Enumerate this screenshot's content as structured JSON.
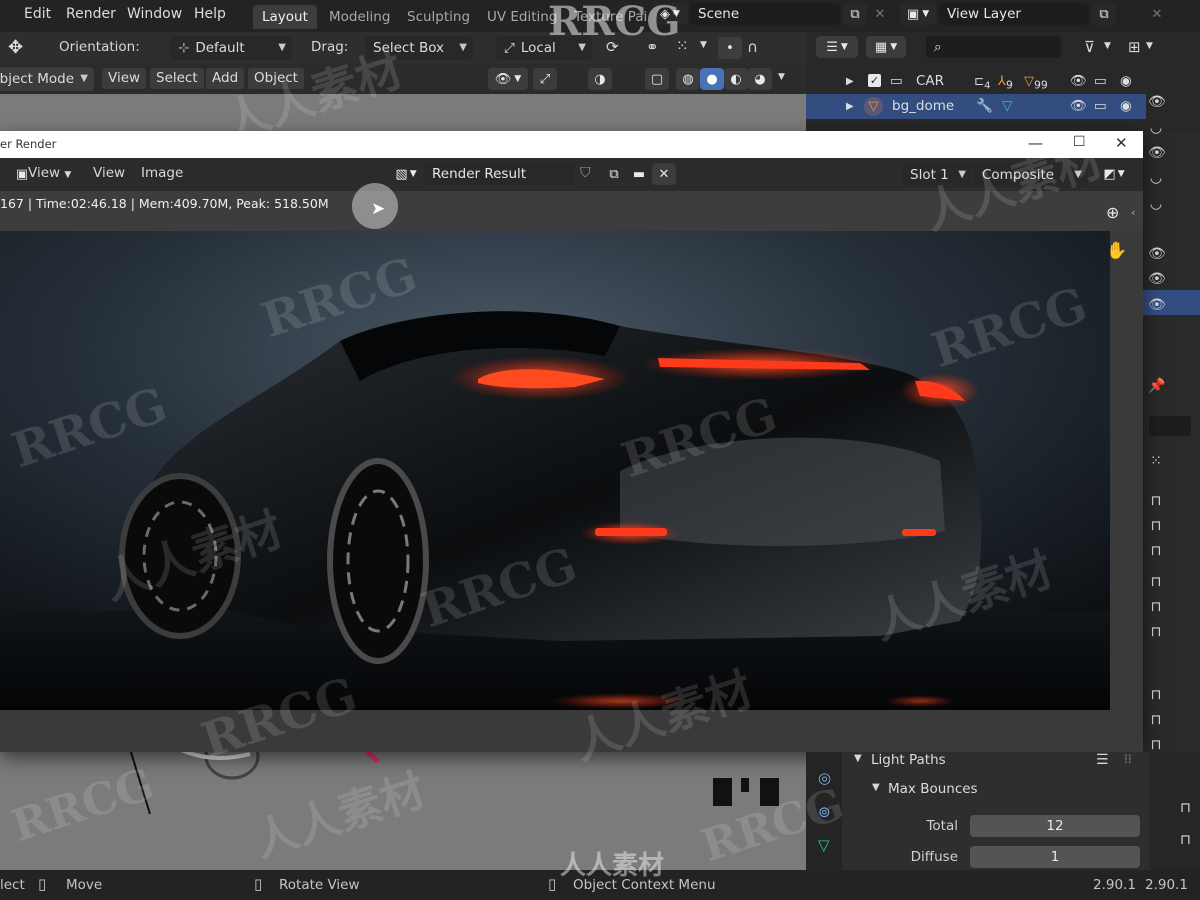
{
  "menu": [
    "Edit",
    "Render",
    "Window",
    "Help"
  ],
  "workspace_tabs": [
    {
      "label": "Layout",
      "active": true
    },
    {
      "label": "Modeling",
      "active": false
    },
    {
      "label": "Sculpting",
      "active": false
    },
    {
      "label": "UV Editing",
      "active": false
    },
    {
      "label": "Texture Pai",
      "active": false
    }
  ],
  "scene": {
    "value": "Scene"
  },
  "view_layer": {
    "value": "View Layer"
  },
  "tool_settings": {
    "orientation_label": "Orientation:",
    "orientation_value": "Default",
    "drag_label": "Drag:",
    "drag_value": "Select Box",
    "transform_value": "Local"
  },
  "viewport_header": {
    "mode": "Object Mode",
    "buttons": [
      "View",
      "Select",
      "Add",
      "Object"
    ]
  },
  "outliner": {
    "rows": [
      {
        "name": "CAR",
        "badges": [
          "4",
          "9",
          "99"
        ],
        "selected": false
      },
      {
        "name": "bg_dome",
        "badges": [],
        "selected": true
      }
    ]
  },
  "render_window": {
    "title": "er Render",
    "menus": [
      "View",
      "View",
      "Image"
    ],
    "image_name": "Render Result",
    "slot": "Slot 1",
    "pass": "Composite",
    "info": "167 | Time:02:46.18 | Mem:409.70M, Peak: 518.50M"
  },
  "properties": {
    "panel_title": "Light Paths",
    "subpanel_title": "Max Bounces",
    "fields": [
      {
        "label": "Total",
        "value": "12"
      },
      {
        "label": "Diffuse",
        "value": "1"
      }
    ]
  },
  "statusbar": {
    "select": "lect",
    "move": "Move",
    "rotate": "Rotate View",
    "context": "Object Context Menu",
    "version": "2.90.1",
    "version2": "2.90.1"
  },
  "watermarks": [
    "RRCG",
    "人人素材"
  ],
  "colors": {
    "accent_blue": "#4772b3",
    "tail_light": "#ff3a1a"
  }
}
